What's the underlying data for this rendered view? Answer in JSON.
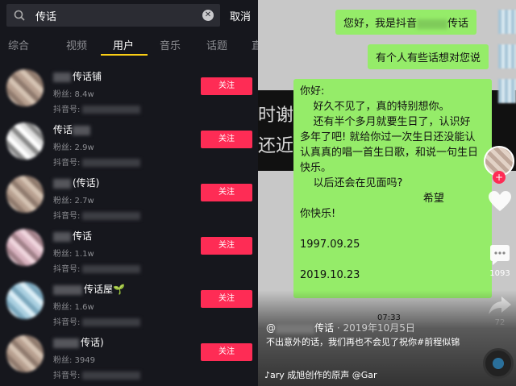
{
  "search": {
    "query": "传话",
    "cancel_label": "取消"
  },
  "tabs": [
    {
      "label": "综合"
    },
    {
      "label": "视频"
    },
    {
      "label": "用户"
    },
    {
      "label": "音乐"
    },
    {
      "label": "话题"
    },
    {
      "label": "直"
    }
  ],
  "users": [
    {
      "name": "传话铺",
      "fans": "粉丝: 8.4w",
      "dyid": "抖音号:",
      "follow": "关注"
    },
    {
      "name": "传话",
      "fans": "粉丝: 2.9w",
      "dyid": "抖音号:",
      "follow": "关注"
    },
    {
      "name": "(传话)",
      "fans": "粉丝: 2.7w",
      "dyid": "抖音号:",
      "follow": "关注"
    },
    {
      "name": "传话",
      "fans": "粉丝: 1.1w",
      "dyid": "抖音号:",
      "follow": "关注"
    },
    {
      "name": "传话屋🌱",
      "fans": "粉丝: 1.6w",
      "dyid": "抖音号:",
      "follow": "关注"
    },
    {
      "name": "传话)",
      "fans": "粉丝: 3949",
      "dyid": "抖音号:",
      "follow": "关注"
    }
  ],
  "video": {
    "bubble1": "您好，我是抖音",
    "bubble1_suffix": "传话",
    "bubble2": "有个人有些话想对您说",
    "message": "你好:\n    好久不见了，真的特别想你。\n    还有半个多月就要生日了，认识好\n多年了吧! 就给你过一次生日还没能认\n认真真的唱一首生日歌，和说一句生日\n快乐。\n    以后还会在见面吗?\n                                     希望\n你快乐!\n\n1997.09.25\n\n2019.10.23",
    "bg_text": "时谢\n还近",
    "time": "07:33",
    "author_prefix": "@",
    "author_suffix": "传话",
    "date": "· 2019年10月5日",
    "description": "不出意外的话，我们再也不会见了祝你#前程似锦",
    "music": "♪ary 成旭创作的原声    @Gar",
    "likes": "",
    "comments": "1093",
    "shares": "72"
  },
  "colors": {
    "accent": "#fe2c55",
    "tab_indicator": "#face15",
    "bubble": "#95ec69"
  }
}
